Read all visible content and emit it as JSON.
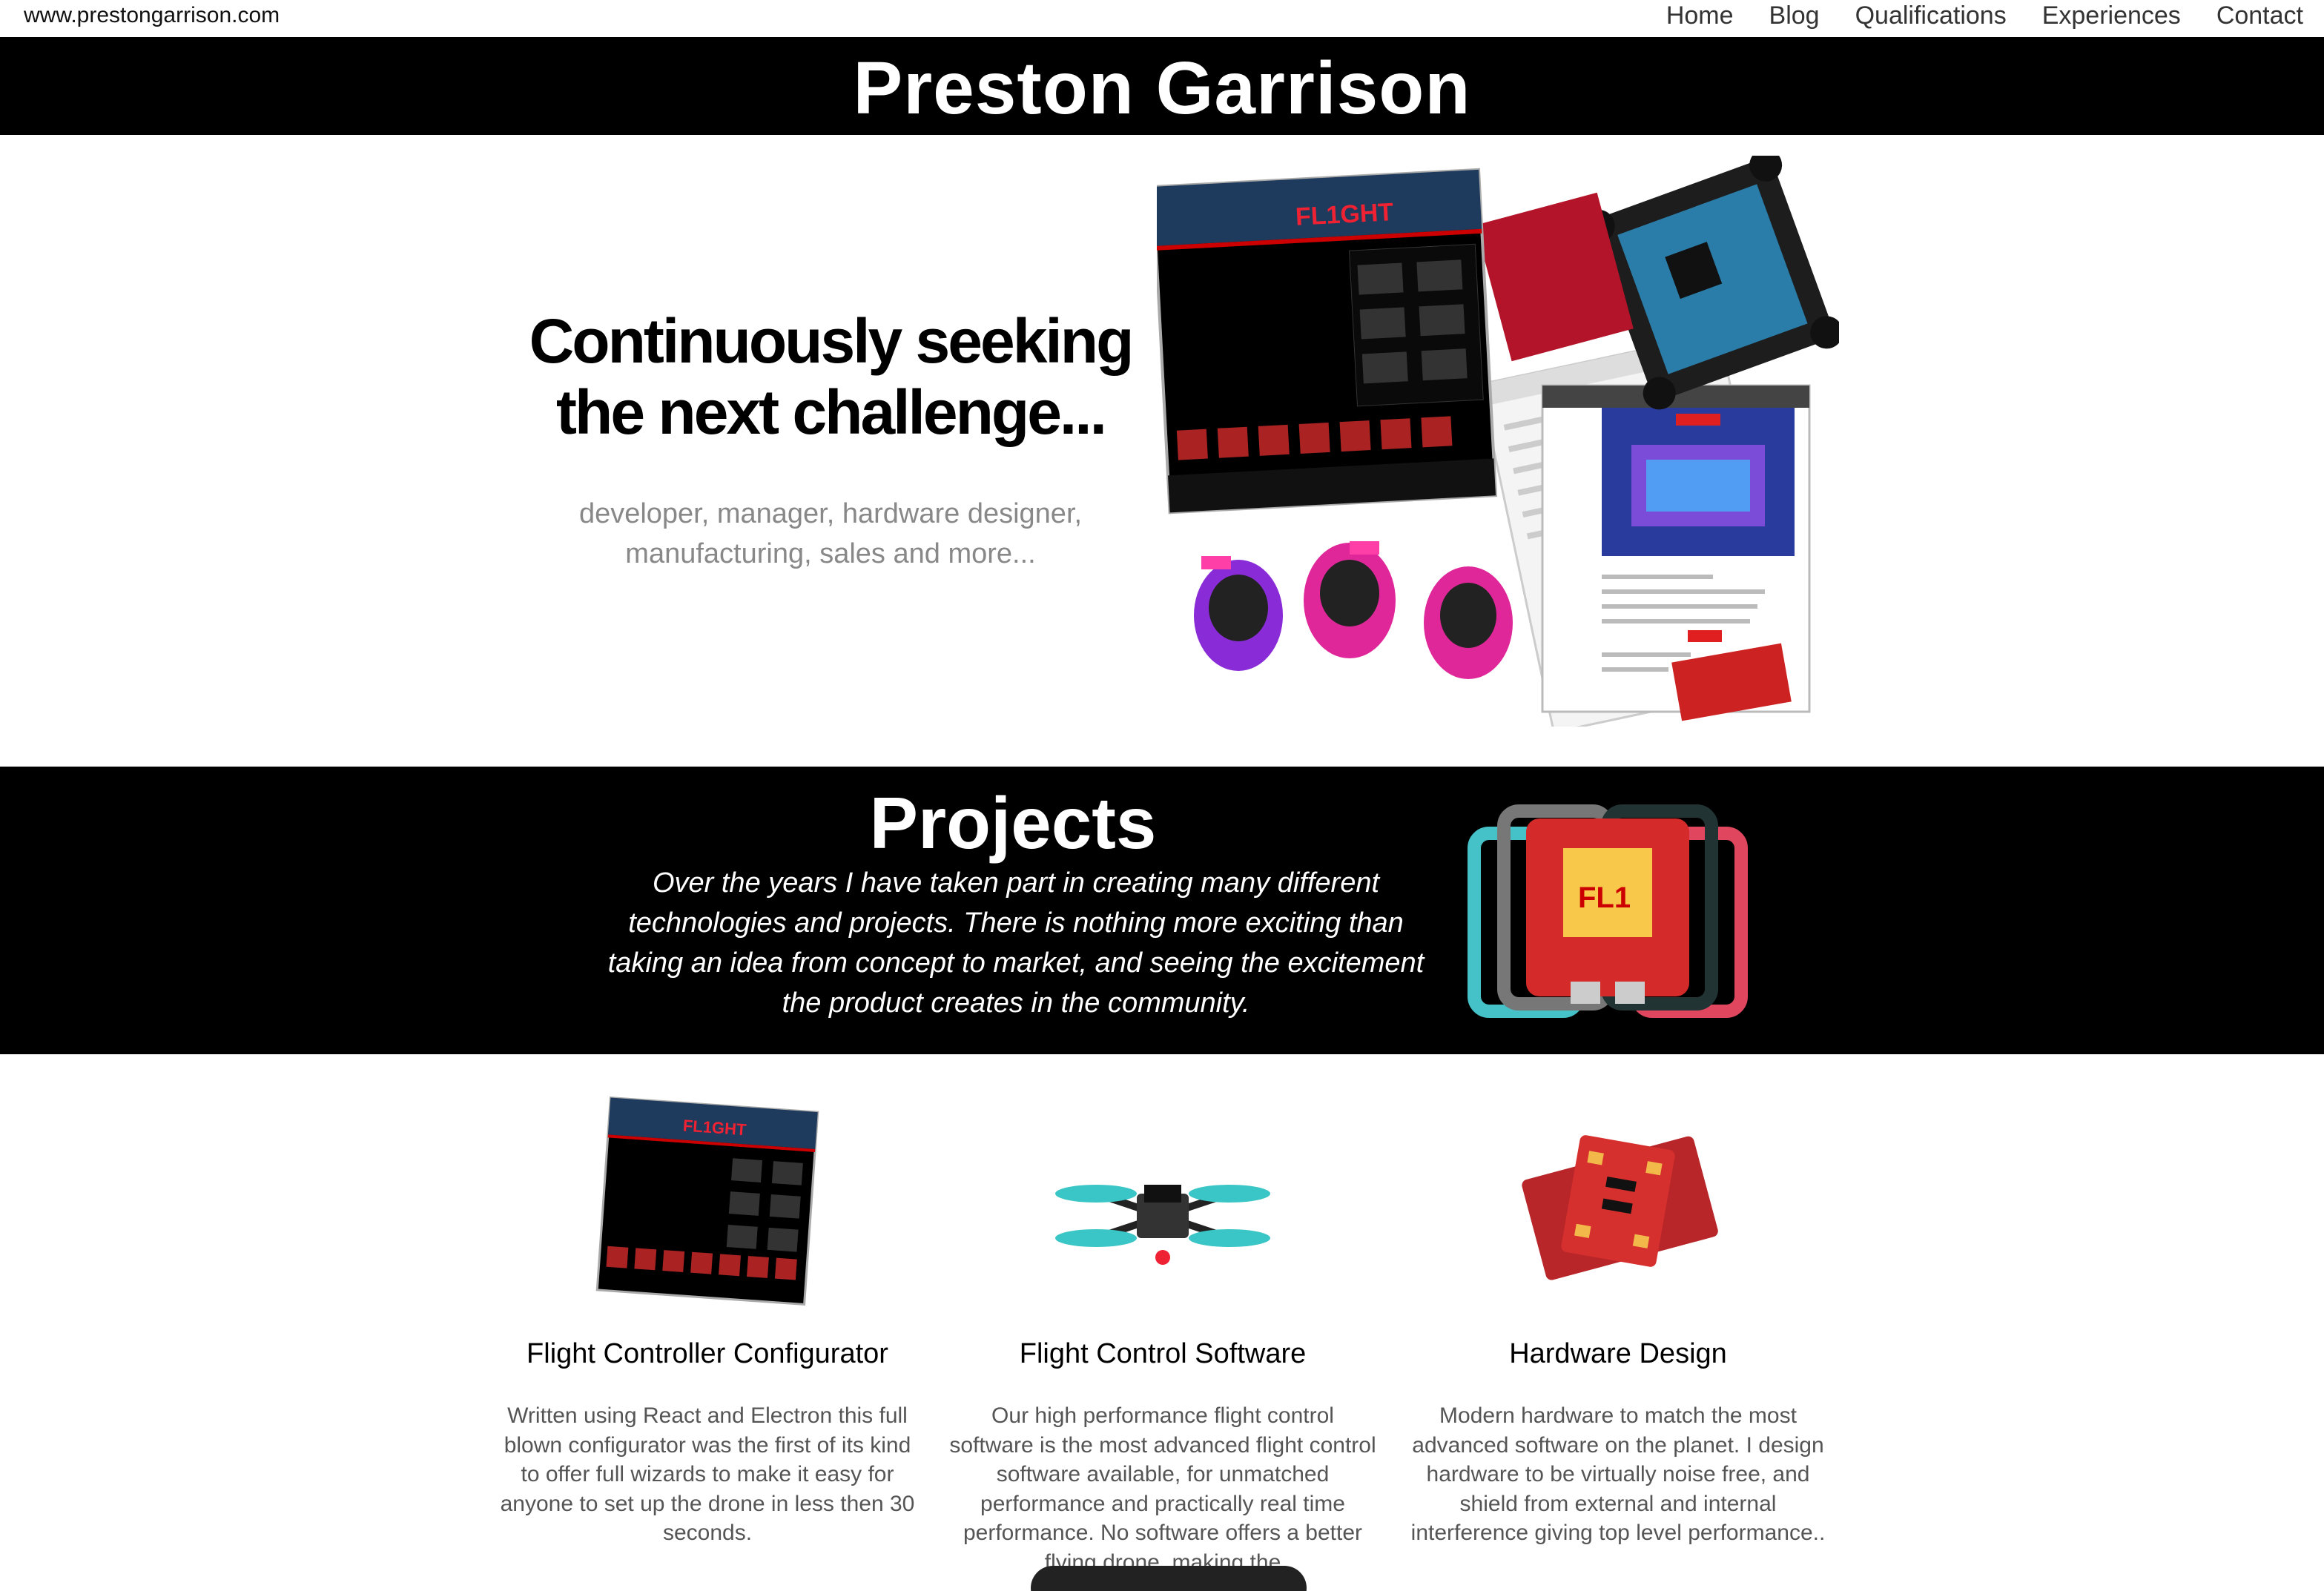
{
  "header": {
    "site_url": "www.prestongarrison.com",
    "nav": [
      "Home",
      "Blog",
      "Qualifications",
      "Experiences",
      "Contact"
    ]
  },
  "title_band": {
    "title": "Preston Garrison"
  },
  "hero": {
    "headline_line1": "Continuously seeking",
    "headline_line2": "the next challenge...",
    "sub_line1": "developer, manager, hardware designer,",
    "sub_line2": "manufacturing, sales and more..."
  },
  "projects": {
    "title": "Projects",
    "text_line1": "Over the years I have taken part in creating many different",
    "text_line2": "technologies and projects. There is nothing more exciting than",
    "text_line3": "taking an idea from concept to market, and seeing the excitement",
    "text_line4": "the product creates in the community."
  },
  "cards": [
    {
      "title": "Flight Controller Configurator",
      "desc": "Written using React and Electron this full blown configurator was the first of its kind to offer full wizards to make it easy for anyone to set up the drone in less then 30 seconds.",
      "icon": "configurator-screenshot"
    },
    {
      "title": "Flight Control Software",
      "desc": "Our high performance flight control software is the most advanced flight control software available, for unmatched performance and practically real time performance. No software offers a better flying drone, making the",
      "icon": "quadcopter-drone"
    },
    {
      "title": "Hardware Design",
      "desc": "Modern hardware to match the most advanced software on the planet. I design hardware to be virtually noise free, and shield from external and internal interference giving top level performance..",
      "icon": "esc-boards"
    }
  ],
  "colors": {
    "band": "#000000",
    "hero_sub": "#888888",
    "card_desc": "#555555",
    "nav": "#333333"
  }
}
